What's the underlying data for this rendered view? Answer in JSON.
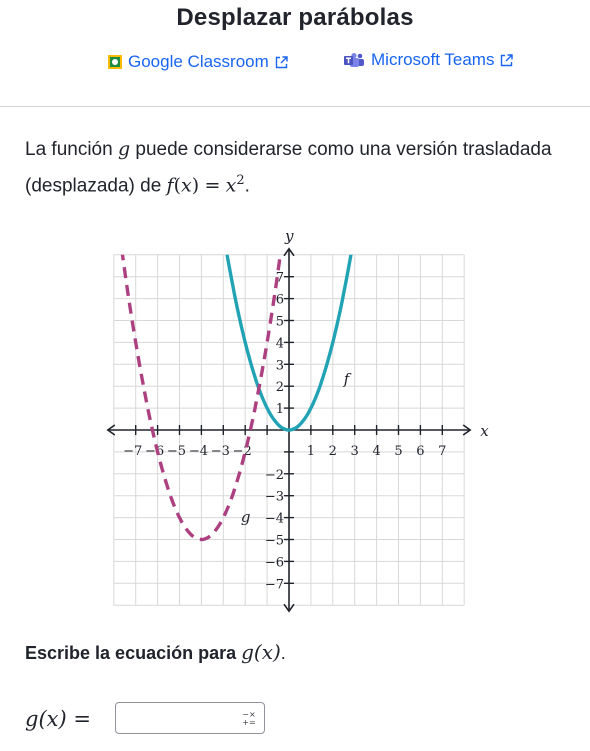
{
  "page": {
    "title": "Desplazar parábolas"
  },
  "share": {
    "classroom_label": "Google Classroom",
    "teams_label": "Microsoft Teams"
  },
  "problem": {
    "text_part1": "La función ",
    "g": "g",
    "text_part2": " puede considerarse como una versión trasladada (desplazada) de ",
    "f_of_x": "f",
    "x": "x",
    "eq": "=",
    "exponent": "2",
    "period": "."
  },
  "graph": {
    "x_axis_label": "x",
    "y_axis_label": "y",
    "curve_f_label": "f",
    "curve_g_label": "g",
    "x_tick_labels": [
      "−7",
      "−6",
      "−5",
      "−4",
      "−3",
      "−2",
      "1",
      "2",
      "3",
      "4",
      "5",
      "6",
      "7"
    ],
    "y_tick_labels": [
      "7",
      "6",
      "5",
      "4",
      "3",
      "2",
      "1",
      "−2",
      "−3",
      "−4",
      "−5",
      "−6",
      "−7"
    ],
    "colors": {
      "f": "#21a3b5",
      "g": "#ad4080",
      "grid": "#d8d8d8",
      "axis": "#21242c"
    }
  },
  "chart_data": {
    "type": "line",
    "xlim": [
      -8,
      8
    ],
    "ylim": [
      -8,
      8
    ],
    "grid": true,
    "series": [
      {
        "name": "f",
        "equation": "x^2",
        "style": "solid",
        "color": "#21a3b5",
        "points": [
          [
            -3,
            9
          ],
          [
            -2,
            4
          ],
          [
            -1,
            1
          ],
          [
            0,
            0
          ],
          [
            1,
            1
          ],
          [
            2,
            4
          ],
          [
            3,
            9
          ]
        ]
      },
      {
        "name": "g",
        "equation": "(x+4)^2-5",
        "style": "dashed",
        "color": "#ad4080",
        "points": [
          [
            -7.7,
            8.69
          ],
          [
            -7,
            4
          ],
          [
            -6,
            -1
          ],
          [
            -5,
            -4
          ],
          [
            -4,
            -5
          ],
          [
            -3,
            -4
          ],
          [
            -2,
            -1
          ],
          [
            -1,
            4
          ],
          [
            -0.3,
            8.69
          ]
        ]
      }
    ]
  },
  "question": {
    "prompt_bold": "Escribe la ecuación para ",
    "g_of_x": "g(x)",
    "period": "."
  },
  "answer": {
    "label": "g(x) =",
    "value": "",
    "keyboard_icon": "math-keyboard-icon"
  }
}
